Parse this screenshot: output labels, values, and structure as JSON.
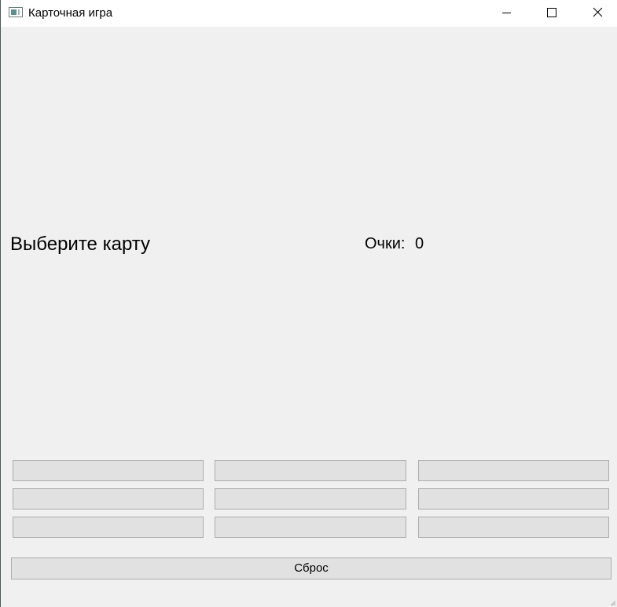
{
  "window": {
    "title": "Карточная игра",
    "icons": {
      "app": "app-window-icon",
      "minimize": "minimize-icon",
      "maximize": "maximize-icon",
      "close": "close-icon"
    }
  },
  "main": {
    "prompt": "Выберите карту",
    "score_label": "Очки:",
    "score_value": "0"
  },
  "cards": [
    {
      "label": ""
    },
    {
      "label": ""
    },
    {
      "label": ""
    },
    {
      "label": ""
    },
    {
      "label": ""
    },
    {
      "label": ""
    },
    {
      "label": ""
    },
    {
      "label": ""
    },
    {
      "label": ""
    }
  ],
  "reset_button": {
    "label": "Сброс"
  },
  "colors": {
    "background": "#f0f0f0",
    "titlebar": "#ffffff",
    "button_face": "#e1e1e1",
    "button_border": "#adadad"
  }
}
